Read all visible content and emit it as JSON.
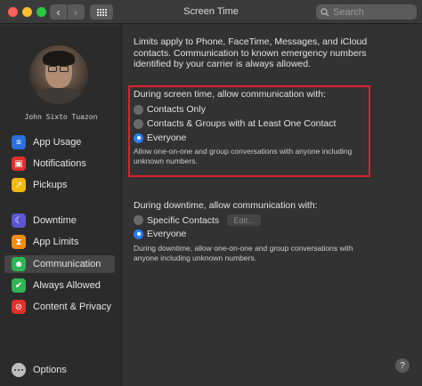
{
  "window": {
    "title": "Screen Time"
  },
  "search": {
    "placeholder": "Search"
  },
  "user": {
    "name": "John Sixto Tuazon"
  },
  "sidebar": {
    "items": [
      {
        "label": "App Usage",
        "icon": "app-usage-icon",
        "color": "#2a6fdb",
        "glyph": "≡"
      },
      {
        "label": "Notifications",
        "icon": "notifications-icon",
        "color": "#e0312b",
        "glyph": "▣"
      },
      {
        "label": "Pickups",
        "icon": "pickups-icon",
        "color": "#f2b90f",
        "glyph": "↗"
      },
      {
        "label": "Downtime",
        "icon": "downtime-icon",
        "color": "#5b57d1",
        "glyph": "☾"
      },
      {
        "label": "App Limits",
        "icon": "app-limits-icon",
        "color": "#f28c13",
        "glyph": "⧗"
      },
      {
        "label": "Communication",
        "icon": "communication-icon",
        "color": "#2fb553",
        "glyph": "☻"
      },
      {
        "label": "Always Allowed",
        "icon": "always-allowed-icon",
        "color": "#2fb553",
        "glyph": "✔"
      },
      {
        "label": "Content & Privacy",
        "icon": "content-privacy-icon",
        "color": "#e0312b",
        "glyph": "⊘"
      }
    ],
    "selected": "Communication",
    "options_label": "Options"
  },
  "main": {
    "intro": "Limits apply to Phone, FaceTime, Messages, and iCloud contacts. Communication to known emergency numbers identified by your carrier is always allowed.",
    "screen_time": {
      "title": "During screen time, allow communication with:",
      "options": [
        "Contacts Only",
        "Contacts & Groups with at Least One Contact",
        "Everyone"
      ],
      "selected": "Everyone",
      "note": "Allow one-on-one and group conversations with anyone including unknown numbers."
    },
    "downtime": {
      "title": "During downtime, allow communication with:",
      "options": [
        "Specific Contacts",
        "Everyone"
      ],
      "selected": "Everyone",
      "edit_label": "Edit...",
      "note": "During downtime, allow one-on-one and group conversations with anyone including unknown numbers."
    }
  },
  "colors": {
    "highlight": "#e0202a",
    "accent": "#2b7bf0"
  }
}
